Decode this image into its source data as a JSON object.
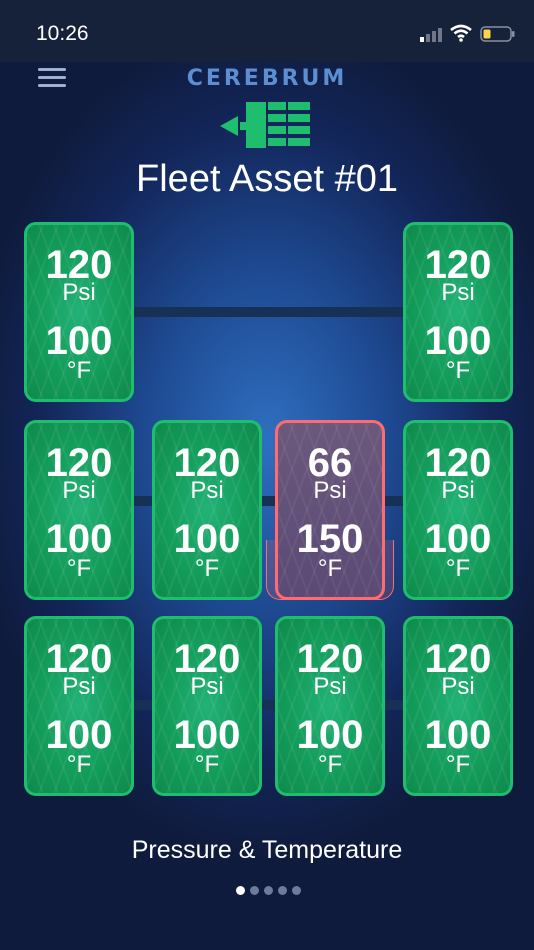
{
  "status_bar": {
    "time": "10:26"
  },
  "header": {
    "brand": "CEREBRUM",
    "title": "Fleet Asset #01"
  },
  "tires": [
    {
      "pressure": "120",
      "pressure_unit": "Psi",
      "temperature": "100",
      "temperature_unit": "°F",
      "status": "ok"
    },
    {
      "pressure": "120",
      "pressure_unit": "Psi",
      "temperature": "100",
      "temperature_unit": "°F",
      "status": "ok"
    },
    {
      "pressure": "120",
      "pressure_unit": "Psi",
      "temperature": "100",
      "temperature_unit": "°F",
      "status": "ok"
    },
    {
      "pressure": "120",
      "pressure_unit": "Psi",
      "temperature": "100",
      "temperature_unit": "°F",
      "status": "ok"
    },
    {
      "pressure": "66",
      "pressure_unit": "Psi",
      "temperature": "150",
      "temperature_unit": "°F",
      "status": "alert"
    },
    {
      "pressure": "120",
      "pressure_unit": "Psi",
      "temperature": "100",
      "temperature_unit": "°F",
      "status": "ok"
    },
    {
      "pressure": "120",
      "pressure_unit": "Psi",
      "temperature": "100",
      "temperature_unit": "°F",
      "status": "ok"
    },
    {
      "pressure": "120",
      "pressure_unit": "Psi",
      "temperature": "100",
      "temperature_unit": "°F",
      "status": "ok"
    },
    {
      "pressure": "120",
      "pressure_unit": "Psi",
      "temperature": "100",
      "temperature_unit": "°F",
      "status": "ok"
    },
    {
      "pressure": "120",
      "pressure_unit": "Psi",
      "temperature": "100",
      "temperature_unit": "°F",
      "status": "ok"
    }
  ],
  "footer": {
    "caption": "Pressure & Temperature",
    "pages": 5,
    "active_page": 1
  },
  "colors": {
    "ok": "#1fbe6e",
    "alert": "#ff6b70",
    "brand": "#5d8ed2"
  }
}
